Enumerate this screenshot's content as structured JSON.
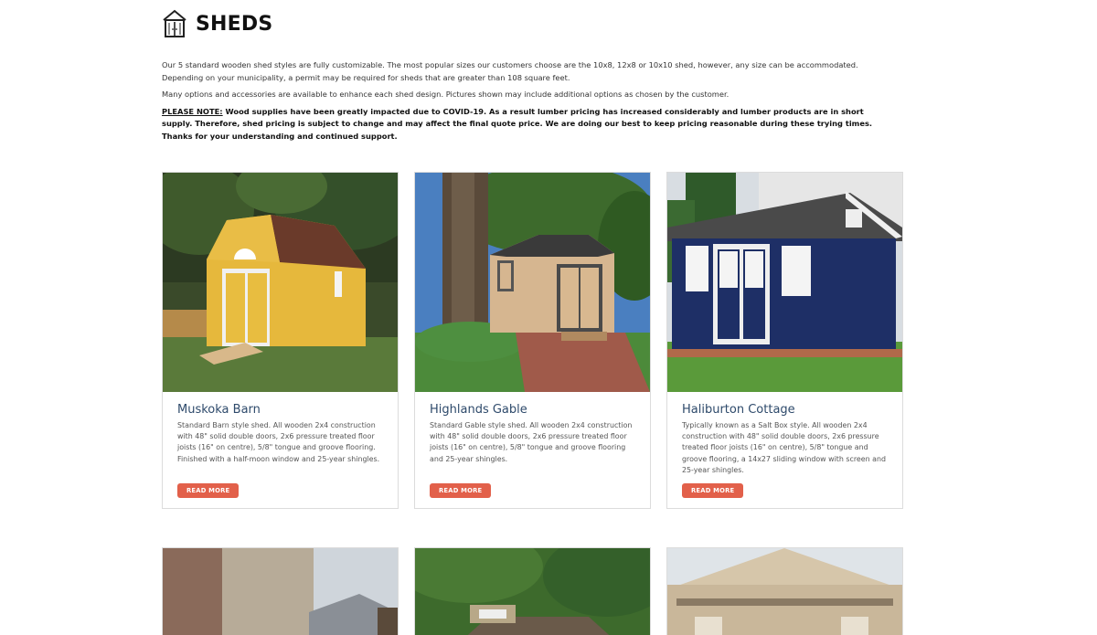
{
  "page": {
    "title": "SHEDS",
    "intro_1": "Our 5 standard wooden shed styles are fully customizable. The most popular sizes our customers choose are the 10x8, 12x8 or 10x10 shed, however, any size can be accommodated. Depending on your municipality, a permit may be required for sheds that are greater than 108 square feet.",
    "intro_2": "Many options and accessories are available to enhance each shed design. Pictures shown may include additional options as chosen by the customer.",
    "note_label": "PLEASE NOTE:",
    "note_text": " Wood supplies have been greatly impacted due to COVID-19. As a result lumber pricing has increased considerably and lumber products are in short supply. Therefore, shed pricing is subject to change and may affect the final quote price. We are doing our best to keep pricing reasonable during these trying times. Thanks for your understanding and continued support."
  },
  "cards": [
    {
      "title": "Muskoka Barn",
      "description": "Standard Barn style shed. All wooden 2x4 construction with 48\" solid double doors, 2x6 pressure treated floor joists (16\" on centre), 5/8\" tongue and groove flooring. Finished with a half-moon window and 25-year shingles.",
      "button": "READ MORE",
      "photo_icon": "yellow-barn-shed-photo"
    },
    {
      "title": "Highlands Gable",
      "description": "Standard Gable style shed. All wooden 2x4 construction with 48\" solid double doors, 2x6 pressure treated floor joists (16\" on centre), 5/8\" tongue and groove flooring and 25-year shingles.",
      "button": "READ MORE",
      "photo_icon": "tan-gable-shed-photo"
    },
    {
      "title": "Haliburton Cottage",
      "description": "Typically known as a Salt Box style. All wooden 2x4 construction with 48\" solid double doors, 2x6 pressure treated floor joists (16\" on centre), 5/8\" tongue and groove flooring, a 14x27 sliding window with screen and 25-year shingles.",
      "button": "READ MORE",
      "photo_icon": "navy-cottage-shed-photo"
    }
  ],
  "colors": {
    "title_blue": "#2e4a6b",
    "button": "#e2604a",
    "card_border": "#dcdcdc"
  }
}
